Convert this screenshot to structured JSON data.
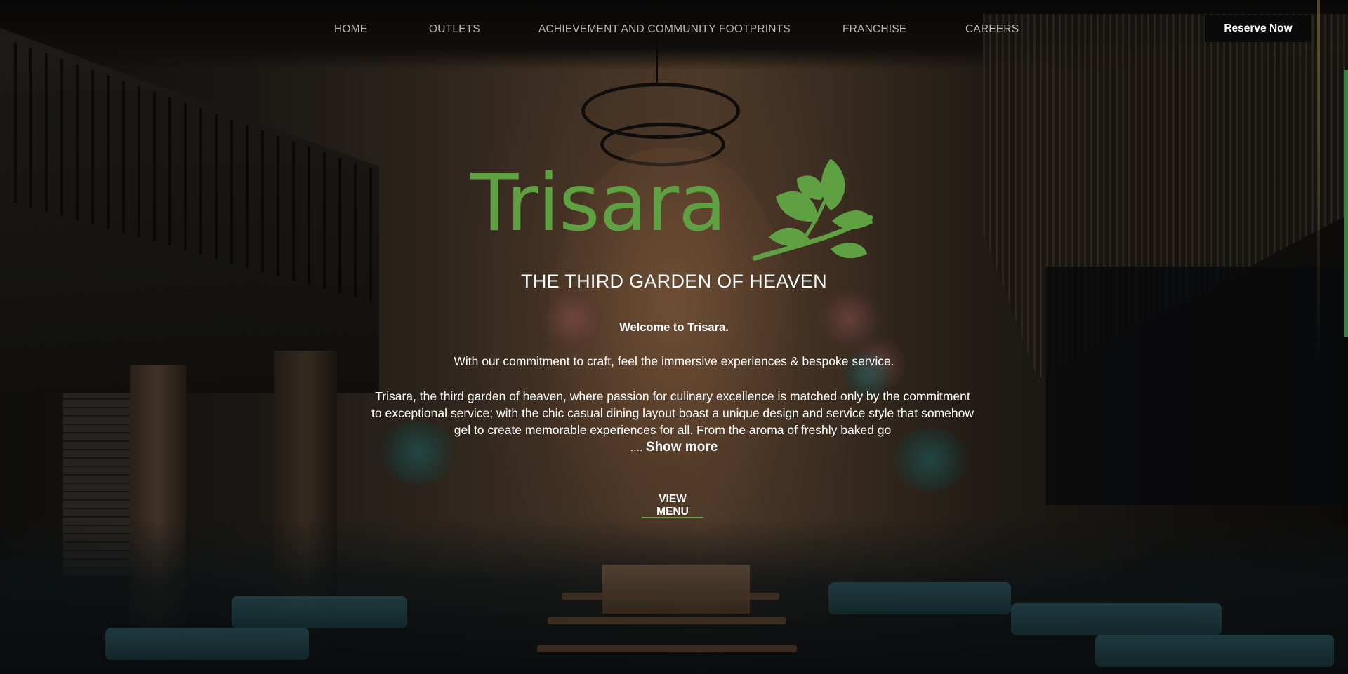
{
  "nav": {
    "items": [
      {
        "label": "HOME"
      },
      {
        "label": "OUTLETS"
      },
      {
        "label": "ACHIEVEMENT AND COMMUNITY FOOTPRINTS"
      },
      {
        "label": "FRANCHISE"
      },
      {
        "label": "CAREERS"
      }
    ],
    "reserve_label": "Reserve Now"
  },
  "hero": {
    "logo_text": "Trisara",
    "logo_icon": "leaf-branch-icon",
    "tagline": "THE THIRD GARDEN OF HEAVEN",
    "welcome": "Welcome to Trisara.",
    "commitment": "With our commitment to craft, feel the immersive experiences & bespoke service.",
    "description": "Trisara, the third garden of heaven, where passion for culinary excellence is matched only by the commitment to exceptional service; with the chic casual dining layout boast a unique design and service style that somehow gel to create memorable experiences for all. From the aroma of freshly baked go",
    "ellipsis": "....",
    "show_more": "Show more",
    "view_menu": "VIEW MENU"
  },
  "colors": {
    "brand_green": "#5fa043",
    "nav_text": "#b9b6b0",
    "reserve_bg": "#0a0a0a"
  }
}
